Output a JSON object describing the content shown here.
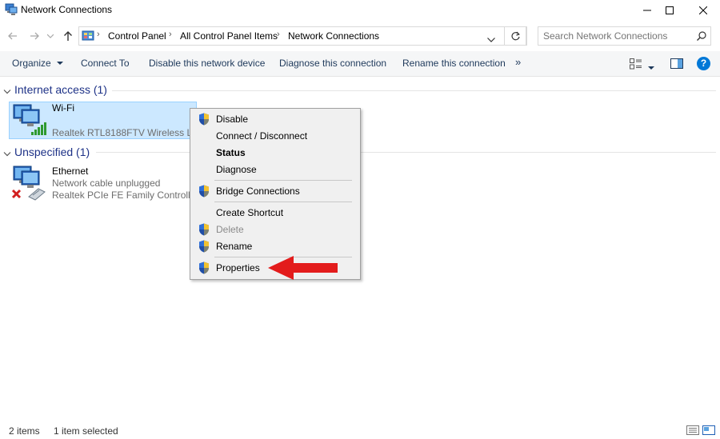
{
  "window": {
    "title": "Network Connections"
  },
  "address": {
    "crumbs": [
      "Control Panel",
      "All Control Panel Items",
      "Network Connections"
    ],
    "search_placeholder": "Search Network Connections"
  },
  "toolbar": {
    "organize": "Organize",
    "connect_to": "Connect To",
    "disable_device": "Disable this network device",
    "diagnose": "Diagnose this connection",
    "rename": "Rename this connection",
    "more": "»"
  },
  "groups": [
    {
      "header": "Internet access (1)",
      "items": [
        {
          "name": "Wi-Fi",
          "line1": "",
          "line2": "Realtek RTL8188FTV Wireless LAN ..."
        }
      ]
    },
    {
      "header": "Unspecified (1)",
      "items": [
        {
          "name": "Ethernet",
          "line1": "Network cable unplugged",
          "line2": "Realtek PCIe FE Family Controller"
        }
      ]
    }
  ],
  "context_menu": {
    "items": [
      {
        "label": "Disable",
        "shield": true
      },
      {
        "label": "Connect / Disconnect",
        "shield": false
      },
      {
        "label": "Status",
        "shield": false,
        "bold": true
      },
      {
        "label": "Diagnose",
        "shield": false
      },
      {
        "label": "Bridge Connections",
        "shield": true
      },
      {
        "label": "Create Shortcut",
        "shield": false
      },
      {
        "label": "Delete",
        "shield": true,
        "disabled": true
      },
      {
        "label": "Rename",
        "shield": true
      },
      {
        "label": "Properties",
        "shield": true
      }
    ]
  },
  "status_bar": {
    "count": "2 items",
    "selected": "1 item selected"
  },
  "colors": {
    "accent": "#1e3287",
    "selection": "#cce8ff",
    "arrow": "#e31c1c",
    "help": "#0078d7"
  }
}
